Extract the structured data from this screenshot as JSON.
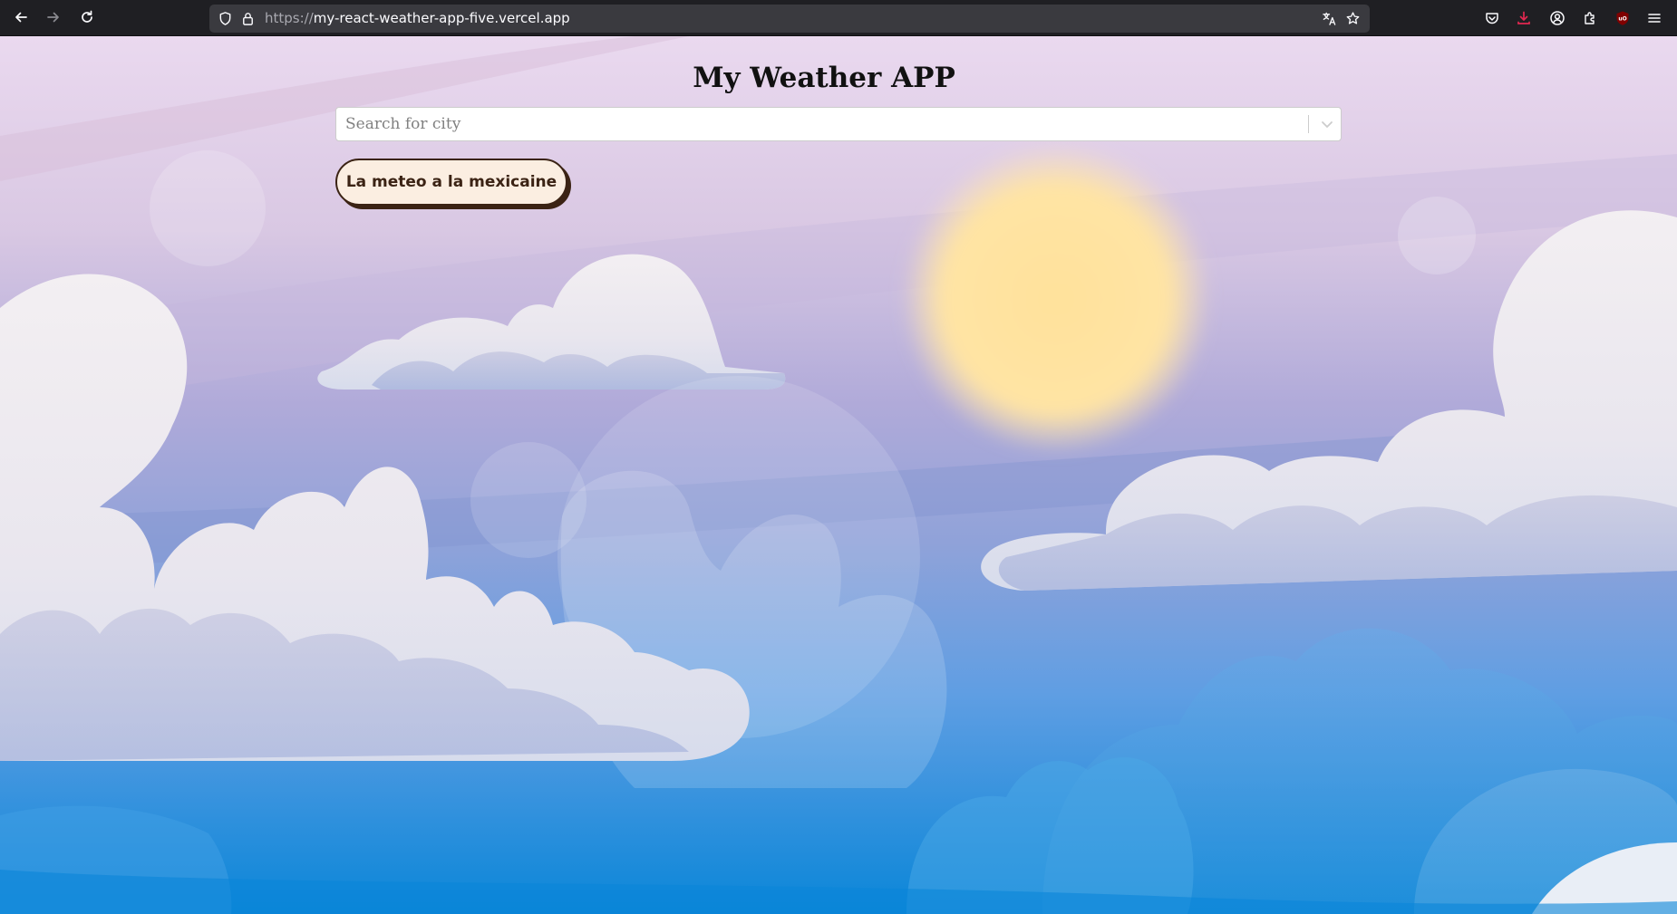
{
  "browser": {
    "url_scheme": "https://",
    "url_host": "my-react-weather-app-five.vercel.app",
    "icons": {
      "back": "back-arrow-icon",
      "forward": "forward-arrow-icon",
      "reload": "reload-icon",
      "tracking_protection": "shield-icon",
      "secure_connection": "lock-icon",
      "translate": "translate-icon",
      "bookmark": "star-icon",
      "pocket": "pocket-icon",
      "downloads": "download-icon",
      "account": "account-icon",
      "extensions": "extensions-icon",
      "ublock": "ublock-origin-icon",
      "menu": "hamburger-menu-icon"
    },
    "colors": {
      "chrome_bg": "#1f1f23",
      "urlbar_bg": "#3a3a3f",
      "download_accent": "#e22850",
      "ublock_red": "#800000"
    }
  },
  "page": {
    "title": "My Weather APP",
    "search": {
      "placeholder": "Search for city",
      "value": ""
    },
    "mexican_button_label": "La meteo a la mexicaine",
    "colors": {
      "button_bg": "#fbeee1",
      "button_border": "#3b2314",
      "sky_top": "#ead9ef",
      "sky_bottom": "#0a86d8",
      "sun": "#ffe19b"
    }
  }
}
